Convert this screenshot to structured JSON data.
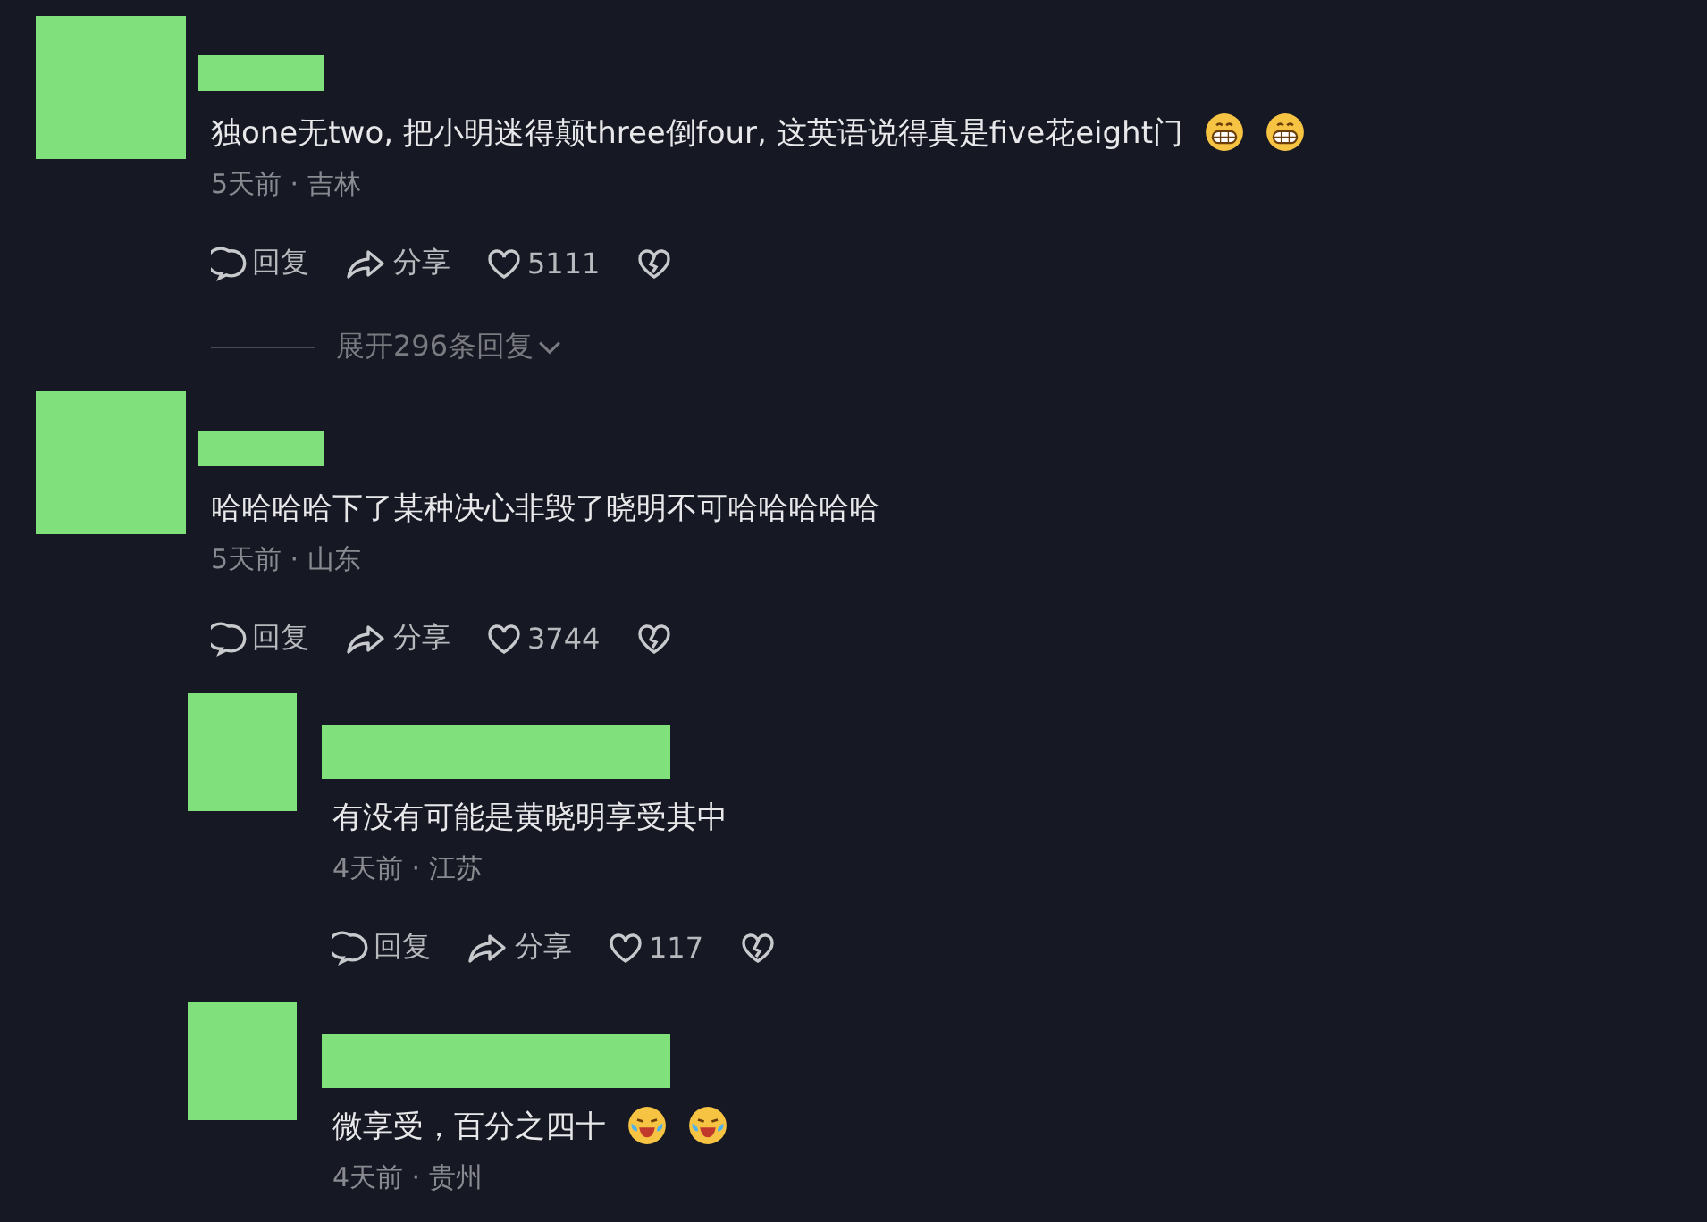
{
  "comments": [
    {
      "text": "独one无two, 把小明迷得颠three倒four, 这英语说得真是five花eight门",
      "emojis": [
        {
          "kind": "grin"
        },
        {
          "kind": "grin"
        }
      ],
      "meta": "5天前 · 吉林",
      "actions": {
        "reply": "回复",
        "share": "分享",
        "likes": "5111"
      },
      "expand": "展开296条回复"
    },
    {
      "text": "哈哈哈哈下了某种决心非毁了晓明不可哈哈哈哈哈",
      "meta": "5天前 · 山东",
      "actions": {
        "reply": "回复",
        "share": "分享",
        "likes": "3744"
      },
      "children": [
        {
          "text": "有没有可能是黄晓明享受其中",
          "meta": "4天前 · 江苏",
          "actions": {
            "reply": "回复",
            "share": "分享",
            "likes": "117"
          }
        },
        {
          "text": "微享受，百分之四十",
          "emojis": [
            {
              "kind": "tears"
            },
            {
              "kind": "tears"
            }
          ],
          "meta": "4天前 · 贵州"
        }
      ]
    }
  ]
}
